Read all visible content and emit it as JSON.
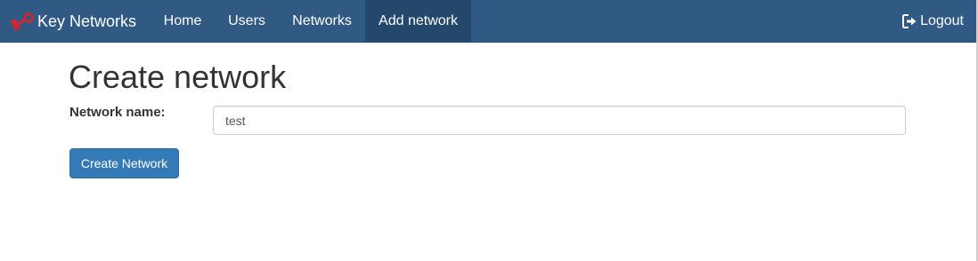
{
  "navbar": {
    "brand": "Key Networks",
    "brand_icon": "key-icon",
    "items": [
      {
        "label": "Home",
        "active": false
      },
      {
        "label": "Users",
        "active": false
      },
      {
        "label": "Networks",
        "active": false
      },
      {
        "label": "Add network",
        "active": true
      }
    ],
    "logout_label": "Logout",
    "logout_icon": "logout-icon"
  },
  "main": {
    "title": "Create network",
    "form": {
      "name_label": "Network name:",
      "name_value": "test",
      "submit_label": "Create Network"
    }
  },
  "colors": {
    "navbar_bg": "#305a84",
    "navbar_active_bg": "#24486c",
    "primary_button": "#337ab7",
    "brand_icon": "#d9232e"
  }
}
